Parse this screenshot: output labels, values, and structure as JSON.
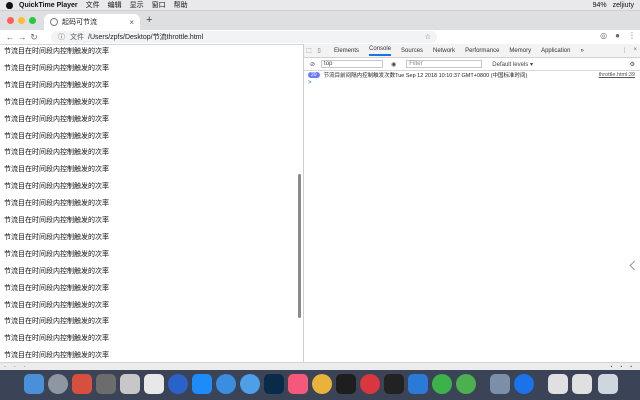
{
  "menubar": {
    "app_name": "QuickTime Player",
    "menus": [
      "文件",
      "编辑",
      "显示",
      "窗口",
      "帮助"
    ],
    "status_items": [
      "94%",
      "zeljiuty"
    ]
  },
  "browser": {
    "tab_title": "起码可节流",
    "url_prefix": "文件",
    "url": "/Users/zpfs/Desktop/节流throttle.html"
  },
  "page": {
    "row_text": "节流目在时间段内控制触发的次率",
    "row_count": 19
  },
  "devtools": {
    "tabs": [
      "Elements",
      "Console",
      "Sources",
      "Network",
      "Performance",
      "Memory",
      "Application"
    ],
    "active_tab": "Console",
    "more_tabs": "»",
    "context": "top",
    "filter_placeholder": "Filter",
    "levels": "Default levels ▾",
    "log_count": "20",
    "log_message": "节流目前间隔内控制触发次数Tue Sep 12 2018 10:10:37 GMT+0800 (中国标准时间)",
    "log_source": "throttle.html:39",
    "prompt": ">"
  },
  "colors": {
    "accent": "#1a73e8",
    "dock": "#3a4456",
    "badge": "#6b7cff"
  }
}
